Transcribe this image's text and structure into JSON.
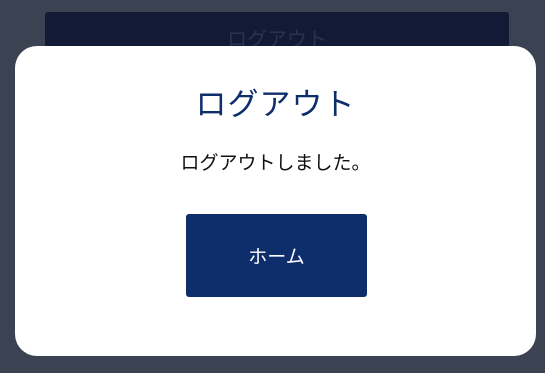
{
  "background": {
    "button_label": "ログアウト"
  },
  "dialog": {
    "title": "ログアウト",
    "message": "ログアウトしました。",
    "home_button_label": "ホーム"
  },
  "colors": {
    "overlay": "#3b4251",
    "primary": "#0e2d6b",
    "dialog_bg": "#ffffff"
  }
}
